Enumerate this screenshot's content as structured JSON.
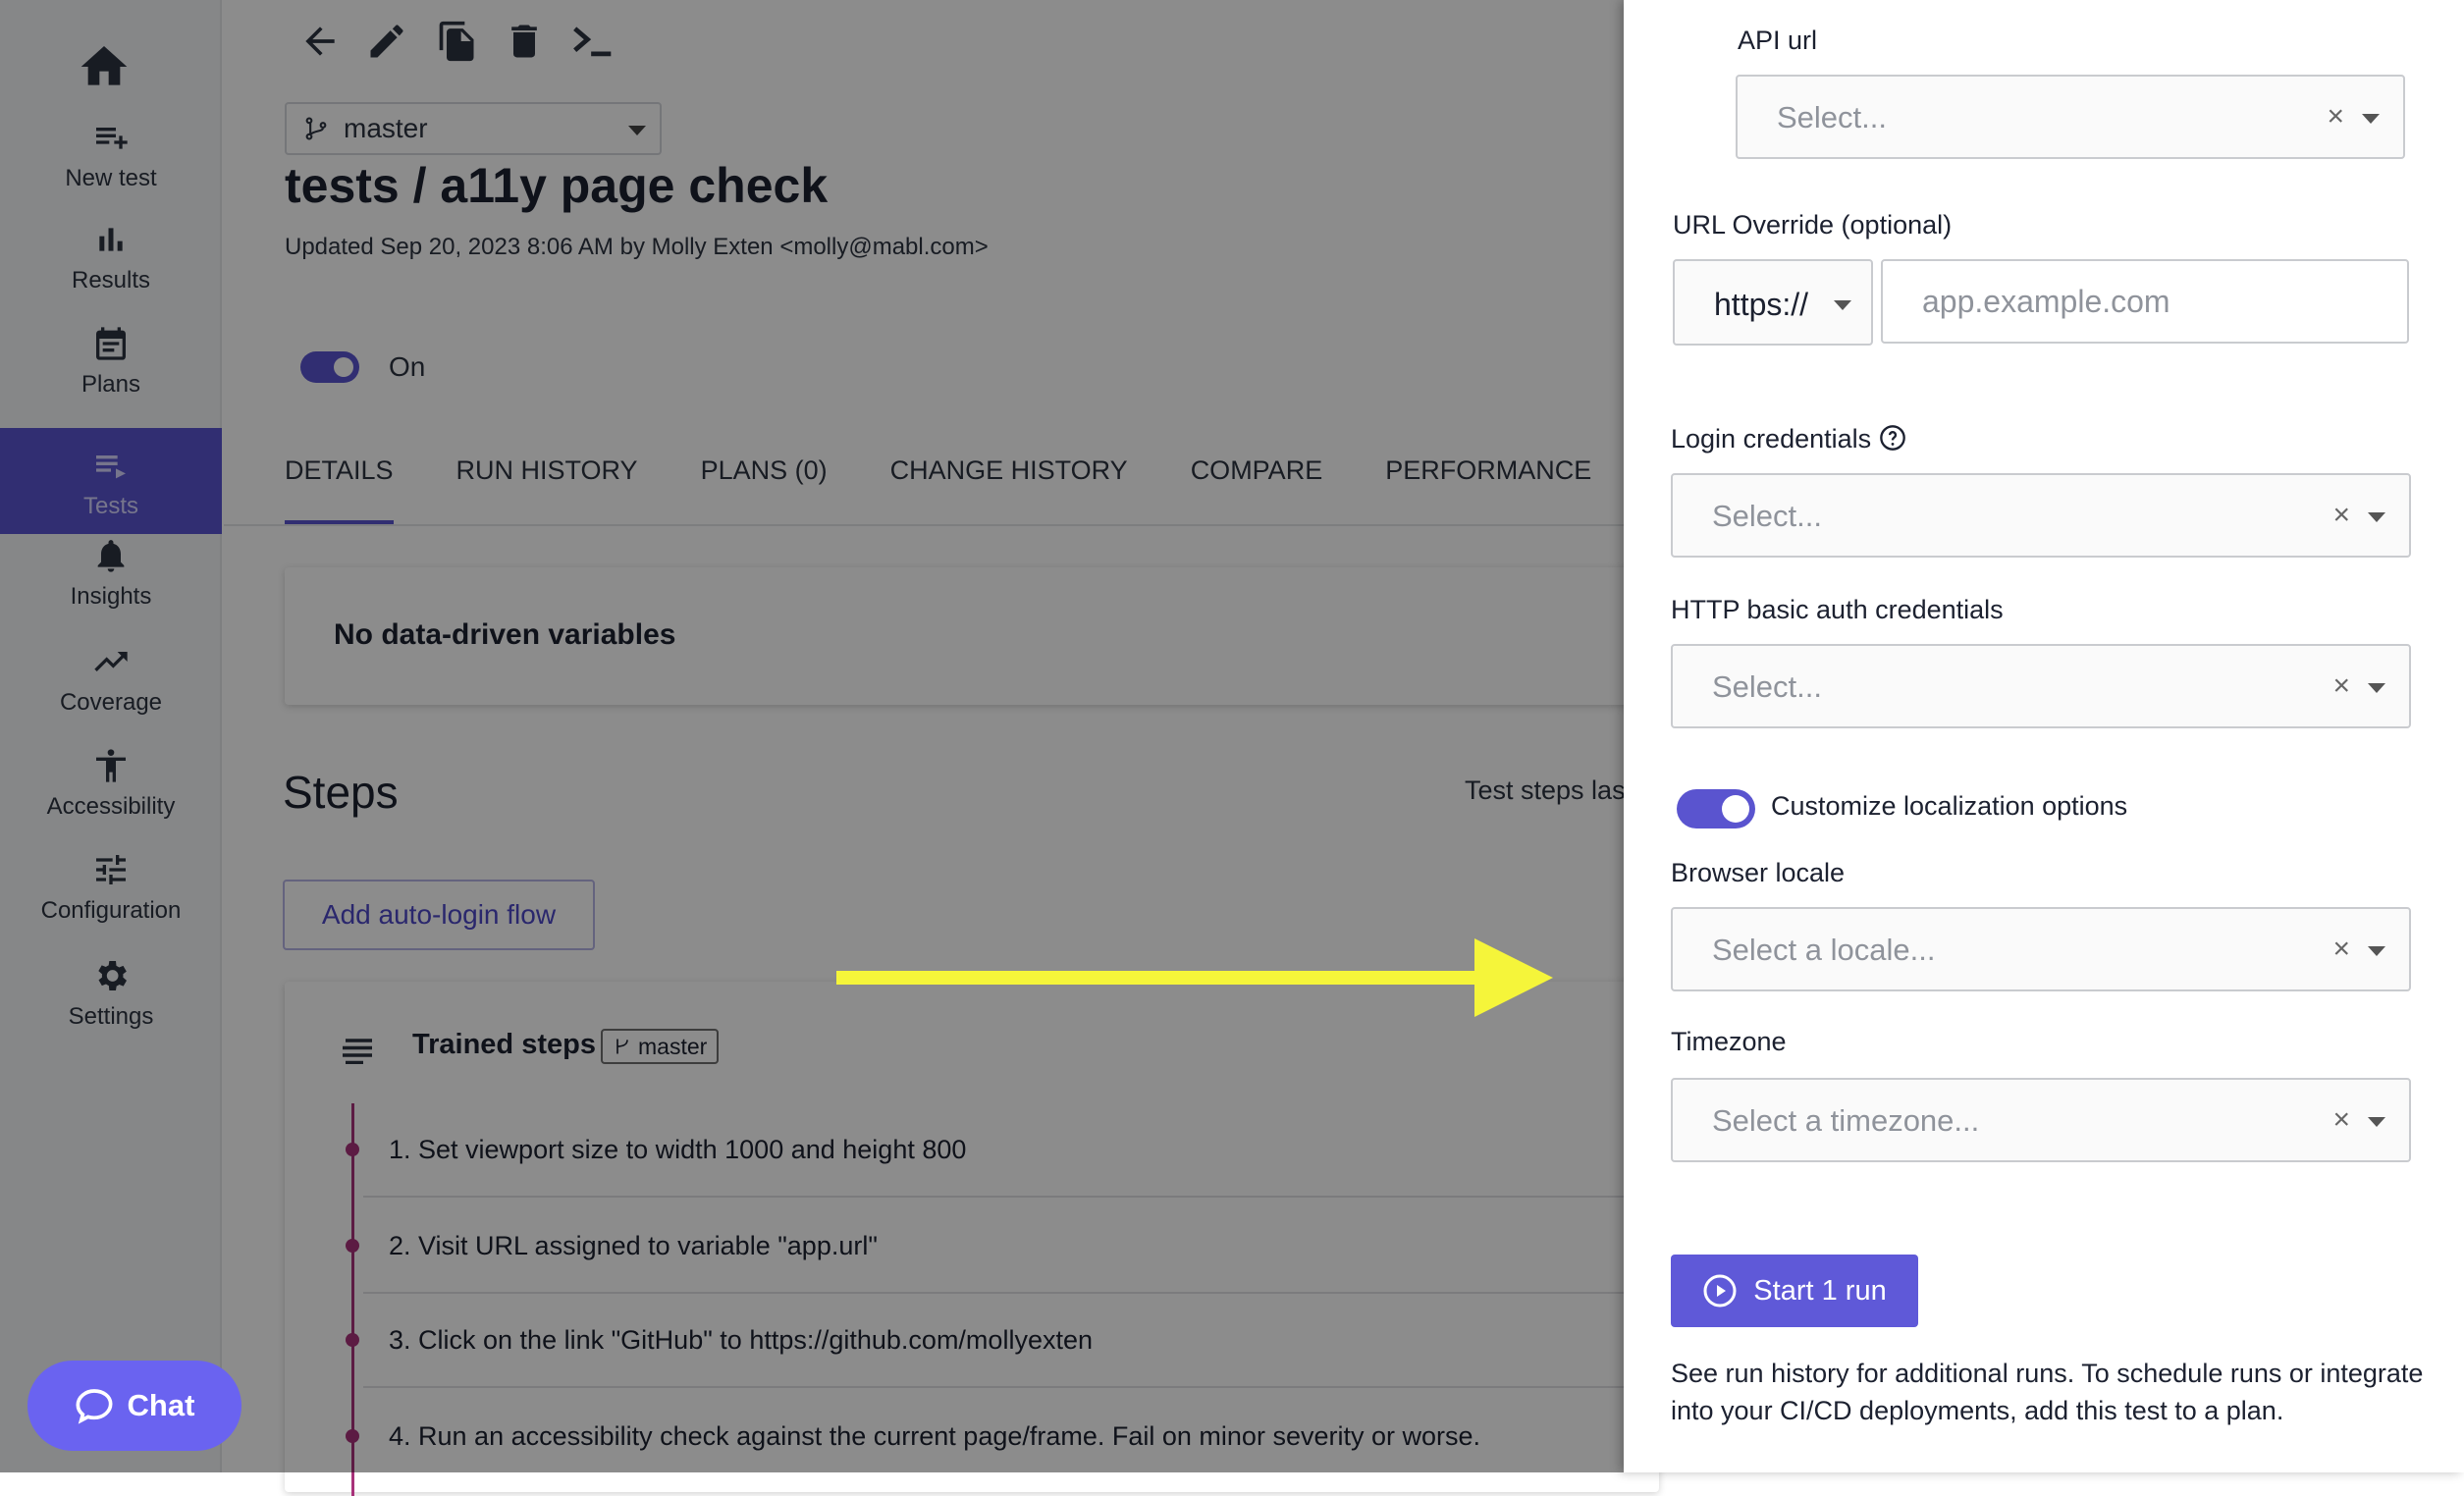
{
  "sidebar": {
    "home_icon": "home-icon",
    "items": [
      {
        "label": "New test",
        "icon": "add-list-icon"
      },
      {
        "label": "Results",
        "icon": "bar-chart-icon"
      },
      {
        "label": "Plans",
        "icon": "calendar-icon"
      },
      {
        "label": "Tests",
        "icon": "playlist-icon",
        "active": true
      },
      {
        "label": "Insights",
        "icon": "bell-icon"
      },
      {
        "label": "Coverage",
        "icon": "trending-up-icon"
      },
      {
        "label": "Accessibility",
        "icon": "accessibility-icon"
      },
      {
        "label": "Configuration",
        "icon": "sliders-icon"
      },
      {
        "label": "Settings",
        "icon": "gear-icon"
      }
    ],
    "chat_label": "Chat"
  },
  "toolbar": {
    "icons": [
      "back-arrow-icon",
      "edit-icon",
      "copy-icon",
      "delete-icon",
      "terminal-icon"
    ]
  },
  "branch": {
    "selected": "master"
  },
  "test": {
    "title": "tests / a11y page check",
    "updated": "Updated Sep 20, 2023 8:06 AM by Molly Exten <molly@mabl.com>",
    "status_label": "On"
  },
  "tabs": [
    {
      "label": "DETAILS",
      "active": true
    },
    {
      "label": "RUN HISTORY"
    },
    {
      "label": "PLANS (0)"
    },
    {
      "label": "CHANGE HISTORY"
    },
    {
      "label": "COMPARE"
    },
    {
      "label": "PERFORMANCE"
    }
  ],
  "ddv": {
    "text": "No data-driven variables"
  },
  "steps": {
    "title": "Steps",
    "last_text": "Test steps las",
    "auto_login_button": "Add auto-login flow",
    "trained_label": "Trained steps",
    "branch_badge": "master",
    "items": [
      "1. Set viewport size to width 1000 and height 800",
      "2. Visit URL assigned to variable \"app.url\"",
      "3. Click on the link \"GitHub\" to https://github.com/mollyexten",
      "4. Run an accessibility check against the current page/frame. Fail on minor severity or worse."
    ]
  },
  "panel": {
    "api_url": {
      "label": "API url",
      "placeholder": "Select..."
    },
    "url_override": {
      "label": "URL Override (optional)",
      "protocol": "https://",
      "placeholder": "app.example.com"
    },
    "login_credentials": {
      "label": "Login credentials",
      "placeholder": "Select..."
    },
    "http_auth": {
      "label": "HTTP basic auth credentials",
      "placeholder": "Select..."
    },
    "localization_toggle_label": "Customize localization options",
    "browser_locale": {
      "label": "Browser locale",
      "placeholder": "Select a locale..."
    },
    "timezone": {
      "label": "Timezone",
      "placeholder": "Select a timezone..."
    },
    "clear_symbol": "×",
    "start_button": "Start 1 run",
    "footer_note": "See run history for additional runs. To schedule runs or integrate into your CI/CD deployments, add this test to a plan."
  },
  "colors": {
    "accent": "#5a54cf",
    "timeline": "#a8327a",
    "annotation_arrow": "#f5f53a",
    "chat": "#6a63f0"
  }
}
